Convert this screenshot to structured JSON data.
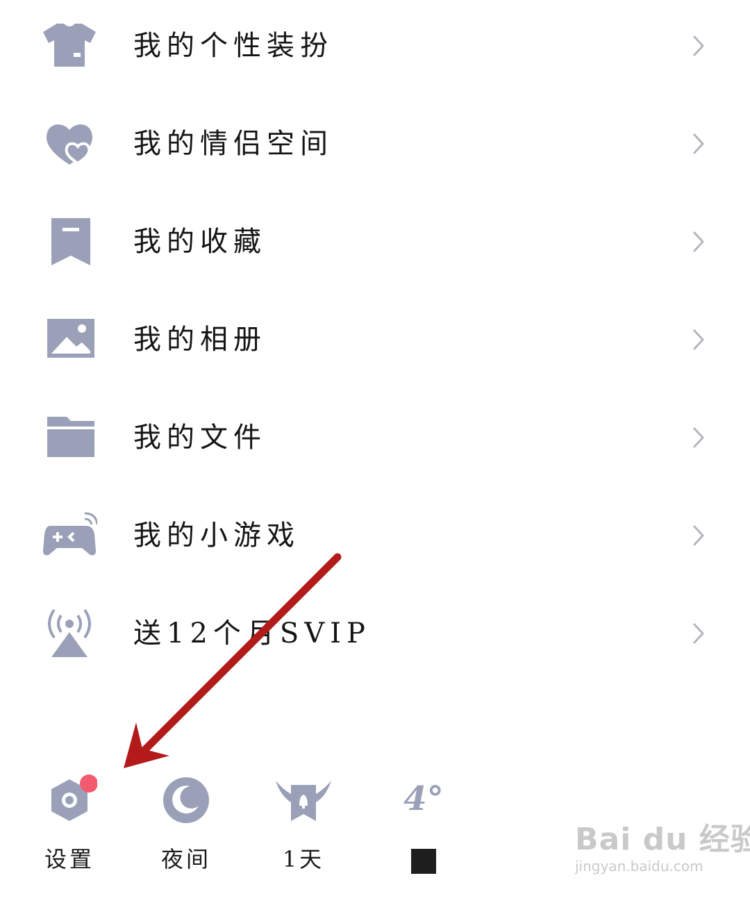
{
  "menu": {
    "items": [
      {
        "icon": "tshirt-icon",
        "label": "我的个性装扮"
      },
      {
        "icon": "heart-icon",
        "label": "我的情侣空间"
      },
      {
        "icon": "bookmark-icon",
        "label": "我的收藏"
      },
      {
        "icon": "image-icon",
        "label": "我的相册"
      },
      {
        "icon": "folder-icon",
        "label": "我的文件"
      },
      {
        "icon": "gamepad-icon",
        "label": "我的小游戏"
      },
      {
        "icon": "broadcast-icon",
        "label": "送12个月SVIP"
      }
    ]
  },
  "bottom_tools": {
    "settings": {
      "icon": "gear-icon",
      "label": "设置",
      "has_badge": true
    },
    "night": {
      "icon": "moon-icon",
      "label": "夜间"
    },
    "checkin": {
      "icon": "winged-bell-icon",
      "label": "1天"
    },
    "weather": {
      "temperature": "4°"
    }
  },
  "watermark": {
    "main": "Bai du 经验",
    "sub": "jingyan.baidu.com"
  },
  "colors": {
    "icon": "#9aa0b8",
    "chevron": "#b4b4bc",
    "badge": "#f45a6e",
    "annotation_arrow": "#b31b1b"
  }
}
